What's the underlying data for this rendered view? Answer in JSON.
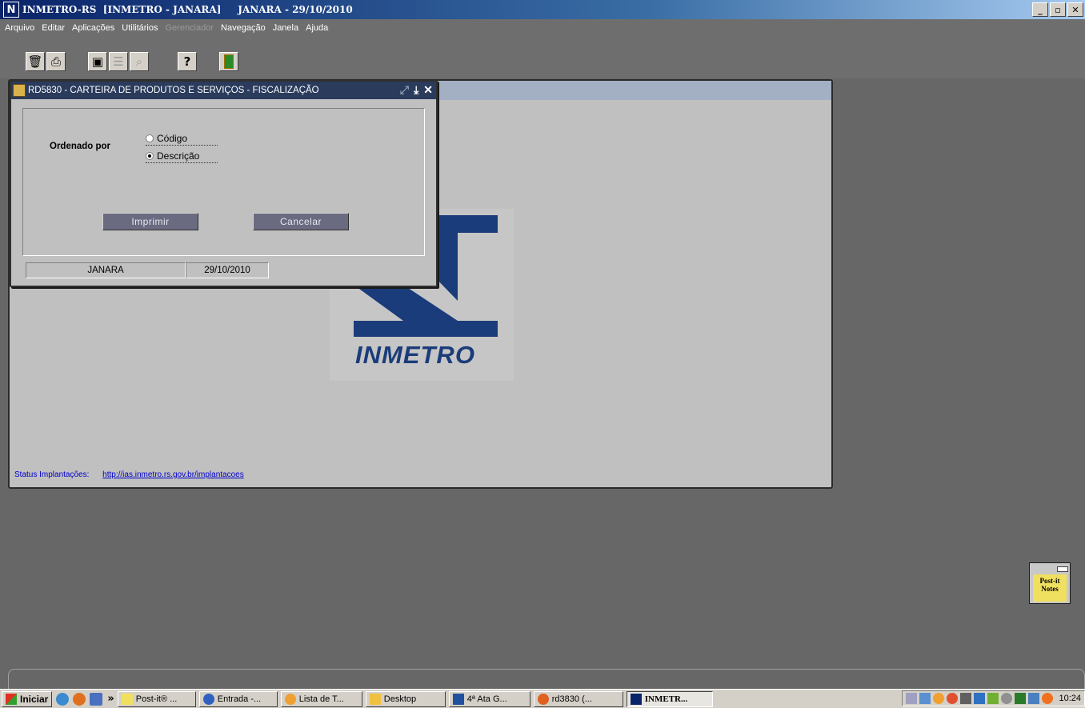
{
  "window": {
    "app_icon": "N",
    "title": "INMETRO-RS  [INMETRO - JANARA]     JANARA - 29/10/2010",
    "controls": [
      "minimize-icon",
      "restore-icon",
      "close-icon"
    ]
  },
  "menu": {
    "items": [
      {
        "label": "Arquivo",
        "enabled": true
      },
      {
        "label": "Editar",
        "enabled": true
      },
      {
        "label": "Aplicações",
        "enabled": true
      },
      {
        "label": "Utilitários",
        "enabled": true
      },
      {
        "label": "Gerenciador",
        "enabled": false
      },
      {
        "label": "Navegação",
        "enabled": true
      },
      {
        "label": "Janela",
        "enabled": true
      },
      {
        "label": "Ajuda",
        "enabled": true
      }
    ]
  },
  "toolbar": {
    "buttons": [
      "trash-icon",
      "print-icon",
      "clipboard-icon",
      "list-icon",
      "search-icon",
      "help-icon",
      "exit-door-icon"
    ]
  },
  "main": {
    "logo_text": "INMETRO",
    "status_label": "Status Implantações:",
    "status_link": "http://ias.inmetro.rs.gov.br/implantacoes"
  },
  "dialog": {
    "title": "RD5830 - CARTEIRA DE PRODUTOS E SERVIÇOS - FISCALIZAÇÃO",
    "ordered_by_label": "Ordenado por",
    "options": [
      {
        "label": "Código",
        "checked": false
      },
      {
        "label": "Descrição",
        "checked": true
      }
    ],
    "print_button": "Imprimir",
    "cancel_button": "Cancelar",
    "user": "JANARA",
    "date": "29/10/2010"
  },
  "postit": {
    "label_line1": "Post-it",
    "label_line2": "Notes"
  },
  "taskbar": {
    "start_label": "Iniciar",
    "overflow": "»",
    "tasks": [
      {
        "label": "Post-it® ...",
        "icon_color": "#f0e060",
        "active": false
      },
      {
        "label": "Entrada -...",
        "icon_color": "#3060c0",
        "active": false
      },
      {
        "label": "Lista de T...",
        "icon_color": "#f0a030",
        "active": false
      },
      {
        "label": "Desktop",
        "icon_color": "#f0c040",
        "active": false
      },
      {
        "label": "4ª Ata G...",
        "icon_color": "#2050a0",
        "active": false
      },
      {
        "label": "rd3830 (...",
        "icon_color": "#e06020",
        "active": false
      },
      {
        "label": "INMETR...",
        "icon_color": "#0a246a",
        "active": true
      }
    ],
    "clock": "10:24"
  }
}
